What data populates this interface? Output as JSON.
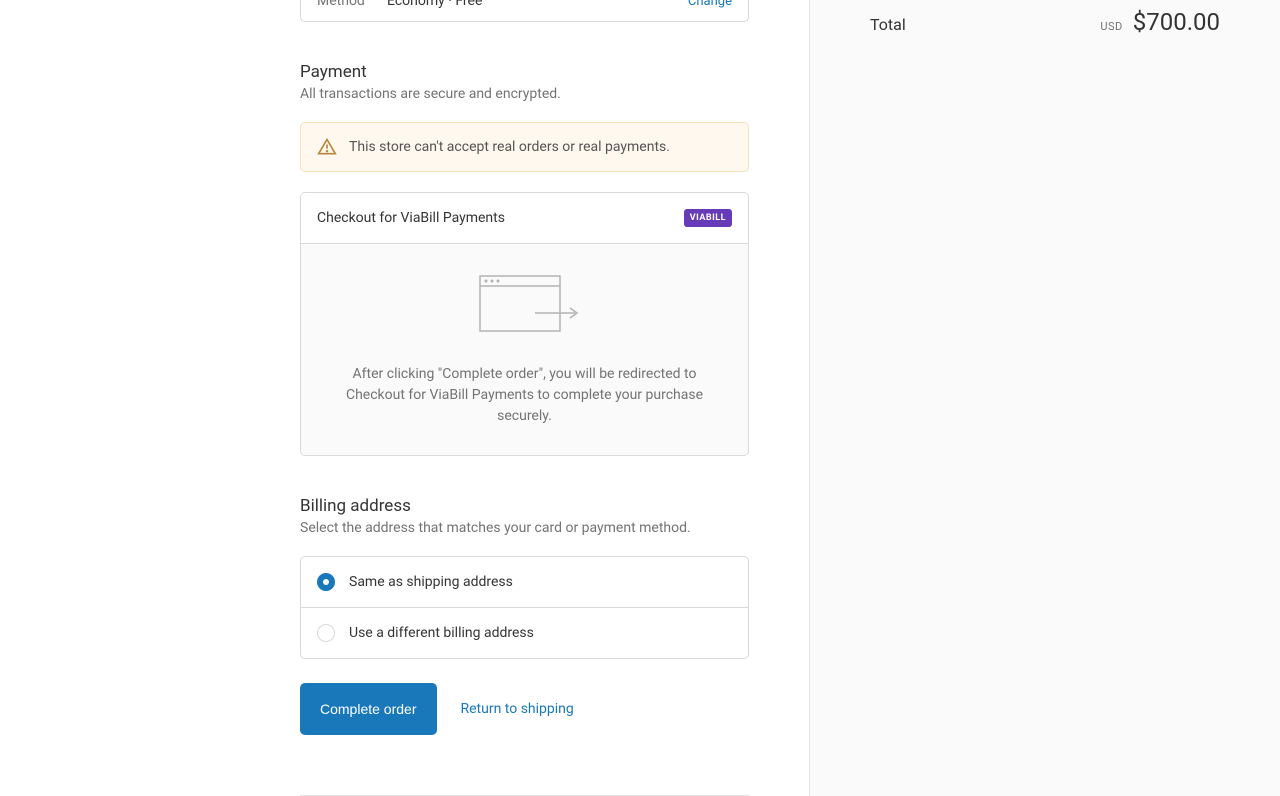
{
  "summary": {
    "method_label": "Method",
    "method_value": "Economy · Free",
    "change": "Change"
  },
  "payment": {
    "title": "Payment",
    "subtitle": "All transactions are secure and encrypted.",
    "warning": "This store can't accept real orders or real payments.",
    "option_label": "Checkout for ViaBill Payments",
    "badge": "VIABILL",
    "description": "After clicking \"Complete order\", you will be redirected to Checkout for ViaBill Payments to complete your purchase securely."
  },
  "billing": {
    "title": "Billing address",
    "subtitle": "Select the address that matches your card or payment method.",
    "same": "Same as shipping address",
    "different": "Use a different billing address"
  },
  "actions": {
    "complete": "Complete order",
    "back": "Return to shipping"
  },
  "sidebar": {
    "total_label": "Total",
    "currency": "USD",
    "total_amount": "$700.00"
  }
}
